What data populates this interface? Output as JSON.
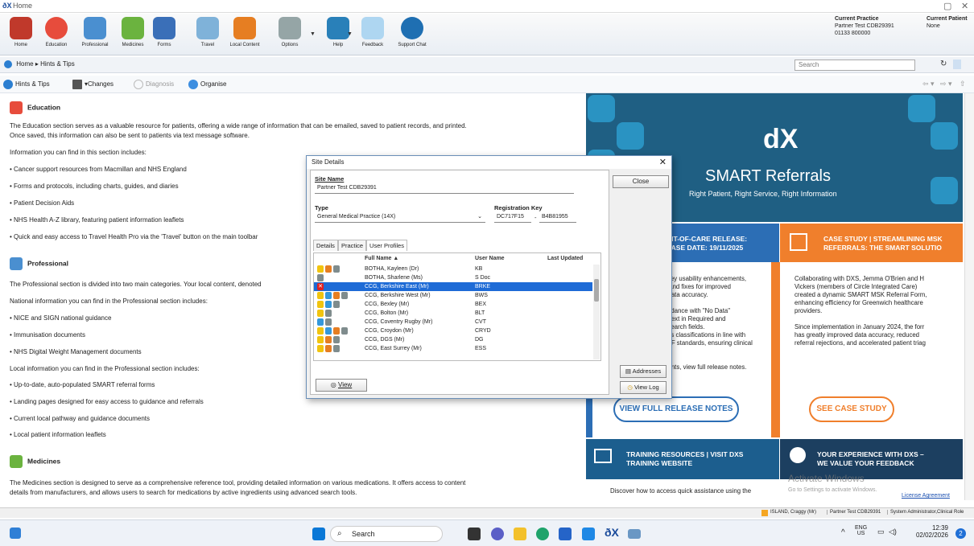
{
  "window": {
    "title": "Home",
    "controls": [
      "▢",
      "✕"
    ]
  },
  "ribbon": {
    "items": [
      "Home",
      "Education",
      "Professional",
      "Medicines",
      "Forms",
      "Travel",
      "Local Content",
      "Options",
      "Help",
      "Feedback",
      "Support Chat"
    ],
    "current_practice_label": "Current Practice",
    "current_practice_name": "Partner Test CDB29391",
    "current_practice_phone": "01133 800000",
    "current_patient_label": "Current Patient",
    "current_patient_value": "None"
  },
  "nav": {
    "breadcrumb": [
      "Home",
      "Hints & Tips"
    ],
    "search_placeholder": "Search"
  },
  "toolbar": {
    "hints": "Hints & Tips",
    "changes": "Changes",
    "diagnosis": "Diagnosis",
    "organise": "Organise"
  },
  "content": {
    "education_title": "Education",
    "education_p1": "The Education section serves as a valuable resource for patients, offering a wide range of information that can be emailed, saved to patient records, and printed.",
    "education_p2": "Once saved, this information can also be sent to patients via text message software.",
    "education_intro": "Information you can find in this section includes:",
    "education_bullets": [
      "Cancer support resources from Macmillan and NHS England",
      "Forms and protocols, including charts, guides, and diaries",
      "Patient Decision Aids",
      "NHS Health A-Z library, featuring patient information leaflets",
      "Quick and easy access to Travel Health Pro via the 'Travel' button on the main toolbar"
    ],
    "professional_title": "Professional",
    "professional_p1": "The Professional section is divided into two main categories. Your local content, denoted",
    "professional_national": "National information you can find in the Professional section includes:",
    "professional_national_bullets": [
      "NICE and SIGN national guidance",
      "Immunisation documents",
      "NHS Digital Weight Management documents"
    ],
    "professional_local": "Local information you can find in the Professional section includes:",
    "professional_local_bullets": [
      "Up-to-date, auto-populated SMART referral forms",
      "Landing pages designed for easy access to guidance and referrals",
      "Current local pathway and guidance documents",
      "Local patient information leaflets"
    ],
    "medicines_title": "Medicines",
    "medicines_p1": "The Medicines section is designed to serve as a comprehensive reference tool, providing detailed information on various medications. It offers access to content",
    "medicines_p2": "details from manufacturers, and allows users to search for medications by active ingredients using advanced search tools."
  },
  "right": {
    "banner_logo": "dX",
    "banner_title": "SMART Referrals",
    "banner_tagline": "Right Patient, Right Service, Right Information",
    "p1_title_1": "INT-OF-CARE RELEASE:",
    "p1_title_2": "EASE DATE: 19/11/2025",
    "p1_lines": [
      "s key usability enhancements,",
      "s, and fixes for improved",
      "d data accuracy.",
      "",
      "guidance with \"No Data\"",
      "nt text in Required and",
      "d search fields.",
      "ines classifications in line with",
      "BNF standards, ensuring clinical",
      "",
      "",
      "ments, view full release notes."
    ],
    "p1_button": "VIEW FULL RELEASE NOTES",
    "p2_title_1": "CASE STUDY | STREAMLINING MSK",
    "p2_title_2": "REFERRALS: THE SMART SOLUTIO",
    "p2_lines": [
      "Collaborating with DXS, Jemma O'Brien and H",
      "Vickers (members of Circle Integrated Care)",
      "created a dynamic SMART MSK Referral Form,",
      "enhancing efficiency for Greenwich healthcare",
      "providers.",
      "",
      "Since implementation in January 2024, the forr",
      "has greatly improved data accuracy, reduced",
      "referral rejections, and accelerated patient triag"
    ],
    "p2_button": "SEE CASE STUDY",
    "p3_title_1": "TRAINING RESOURCES | VISIT DXS",
    "p3_title_2": "TRAINING WEBSITE",
    "p3_text": "Discover how to access quick assistance using the",
    "p4_title_1": "YOUR EXPERIENCE WITH DXS –",
    "p4_title_2": "WE VALUE YOUR FEEDBACK",
    "p4_text": "Go to Settings to activate Windows.",
    "activate_windows": "Activate Windows",
    "license": "License Agreement"
  },
  "dialog": {
    "title": "Site Details",
    "site_name_label": "Site Name",
    "site_name_value": "Partner Test CDB29391",
    "type_label": "Type",
    "type_value": "General Medical Practice (14X)",
    "reg_label": "Registration Key",
    "reg_key_1": "DC717F15",
    "reg_dash": "-",
    "reg_key_2": "B4B81955",
    "tabs": [
      "Details",
      "Practice",
      "User Profiles"
    ],
    "columns": [
      "Full Name ▲",
      "User Name",
      "Last Updated"
    ],
    "rows": [
      {
        "name": "BOTHA, Kayleen (Dr)",
        "user": "KB"
      },
      {
        "name": "BOTHA, Sharlene (Ms)",
        "user": "S Doc"
      },
      {
        "name": "CCG, Berkshire East (Mr)",
        "user": "BRKE"
      },
      {
        "name": "CCG, Berkshire West (Mr)",
        "user": "BWS"
      },
      {
        "name": "CCG, Bexley (Mr)",
        "user": "BEX"
      },
      {
        "name": "CCG, Bolton (Mr)",
        "user": "BLT"
      },
      {
        "name": "CCG, Coventry Rugby (Mr)",
        "user": "CVT"
      },
      {
        "name": "CCG, Croydon (Mr)",
        "user": "CRYD"
      },
      {
        "name": "CCG, DGS (Mr)",
        "user": "DG"
      },
      {
        "name": "CCG, East Surrey (Mr)",
        "user": "ESS"
      }
    ],
    "close": "Close",
    "addresses": "Addresses",
    "view": "View",
    "view_log": "View Log"
  },
  "statusbar": {
    "user": "ISLAND, Craggy (Mr)",
    "practice": "Partner Test CDB29391",
    "role": "System Administrator,Clinical Role"
  },
  "taskbar": {
    "search": "Search",
    "lang_1": "ENG",
    "lang_2": "US",
    "time": "12:39",
    "date": "02/02/2026",
    "notif": "2"
  }
}
